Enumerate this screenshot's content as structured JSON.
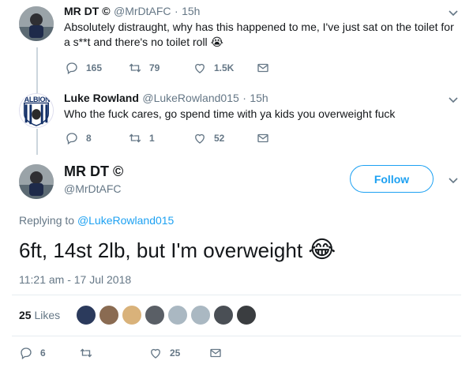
{
  "tweets": [
    {
      "name": "MR DT ©",
      "handle": "@MrDtAFC",
      "time": "15h",
      "text_line1": "Absolutely distraught, why has this happened to me, I've just sat on the toilet for",
      "text_line2": "a s**t and there's no toilet roll",
      "emoji": "😭",
      "replies": "165",
      "retweets": "79",
      "likes": "1.5K"
    },
    {
      "name": "Luke Rowland",
      "handle": "@LukeRowland015",
      "time": "15h",
      "text": "Who the fuck cares, go spend time with ya kids you overweight fuck",
      "replies": "8",
      "retweets": "1",
      "likes": "52",
      "avatar_text": "ALBION"
    }
  ],
  "main_tweet": {
    "name": "MR DT ©",
    "handle": "@MrDtAFC",
    "follow_label": "Follow",
    "replying_prefix": "Replying to",
    "replying_to": "@LukeRowland015",
    "text": "6ft, 14st 2lb, but I'm overweight",
    "emoji": "😂",
    "timestamp": "11:21 am - 17 Jul 2018",
    "likes_count": "25",
    "likes_label": "Likes",
    "replies": "6",
    "retweets": "",
    "likes": "25"
  },
  "icons": {
    "reply": "reply-icon",
    "retweet": "retweet-icon",
    "like": "heart-icon",
    "dm": "envelope-icon",
    "more": "chevron-down-icon"
  },
  "colors": {
    "brand": "#1da1f2",
    "muted": "#657786",
    "text": "#14171a",
    "divider": "#e6ecf0"
  },
  "liker_avatars": [
    "#2b3a5c",
    "#8a6b52",
    "#d9b27a",
    "#5a5f66",
    "#aab8c2",
    "#aab8c2",
    "#4a4f55",
    "#3a3d40"
  ]
}
